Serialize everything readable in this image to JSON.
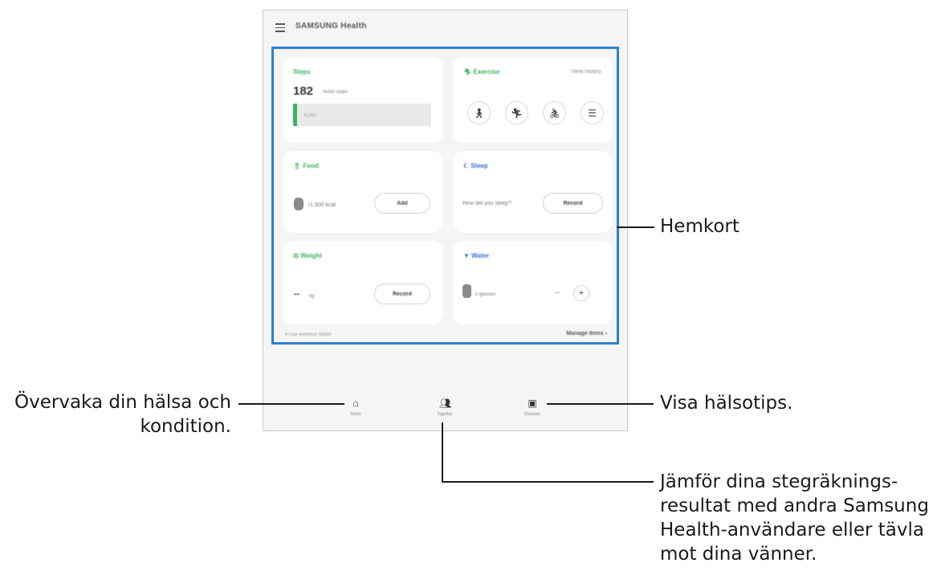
{
  "app": {
    "title": "SAMSUNG Health"
  },
  "cards": {
    "steps": {
      "title": "Steps",
      "value": "182",
      "unit": "/6000 steps",
      "bar_label": "6,000",
      "progress_fraction": 0.03,
      "title_color": "#3db360"
    },
    "exercise": {
      "title": "Exercise",
      "link": "View history",
      "icons": [
        "walking-icon",
        "running-icon",
        "cycling-icon",
        "list-icon"
      ],
      "title_color": "#3db360"
    },
    "food": {
      "title": "Food",
      "value": "/1,900 kcal",
      "button": "Add",
      "title_color": "#3db360"
    },
    "sleep": {
      "title": "Sleep",
      "prompt": "How did you sleep?",
      "button": "Record",
      "title_color": "#3b6fd6"
    },
    "weight": {
      "title": "Weight",
      "value": "--",
      "unit": "kg",
      "button": "Record",
      "title_color": "#3db360"
    },
    "water": {
      "title": "Water",
      "value": "0 glasses",
      "minus": "−",
      "plus": "+",
      "title_color": "#3b6fd6"
    }
  },
  "footer": {
    "left": "▾ Use wellness habits",
    "right": "Manage items ›"
  },
  "nav": [
    {
      "label": "Home",
      "icon": "home-icon"
    },
    {
      "label": "Together",
      "icon": "people-icon"
    },
    {
      "label": "Discover",
      "icon": "calendar-tips-icon"
    }
  ],
  "callouts": {
    "home_cards": "Hemkort",
    "home_tab_line1": "Övervaka din hälsa och",
    "home_tab_line2": "kondition.",
    "discover_tab": "Visa hälsotips.",
    "together_line1": "Jämför dina stegräknings-",
    "together_line2": "resultat med andra Samsung",
    "together_line3": "Health-användare eller tävla",
    "together_line4": "mot dina vänner."
  },
  "colors": {
    "highlight": "#2f7fd4",
    "accent_green": "#3db360",
    "accent_blue": "#3b6fd6"
  }
}
